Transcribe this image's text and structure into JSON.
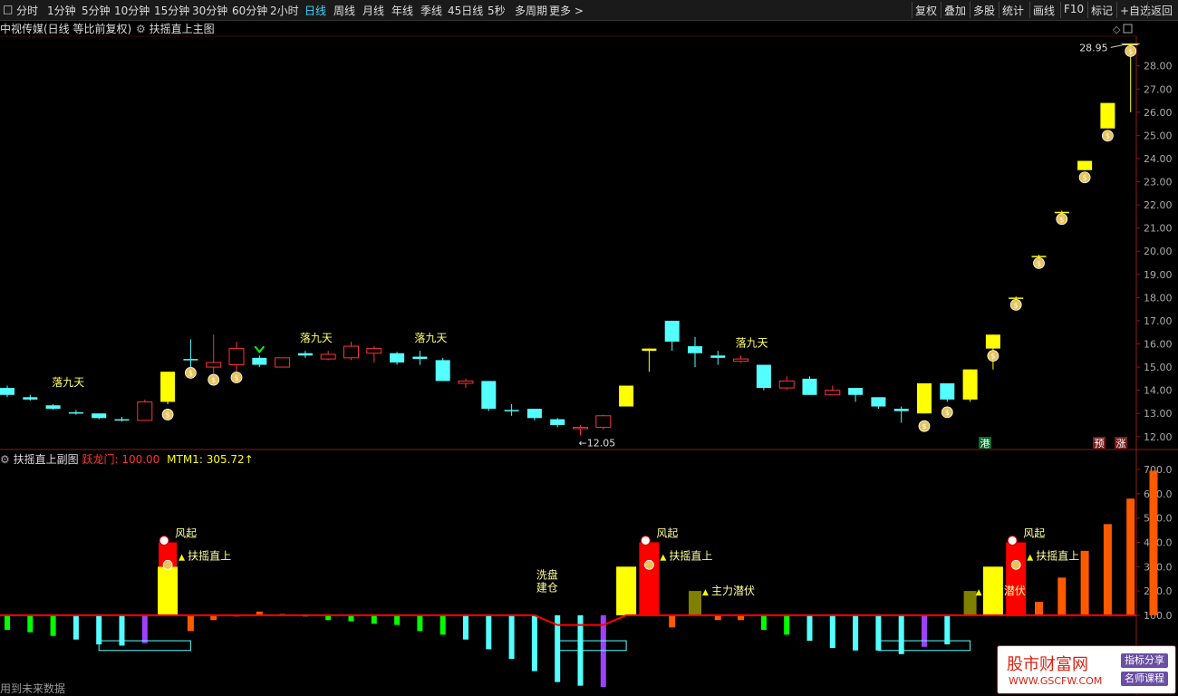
{
  "toolbar": {
    "left": [
      "分时",
      "1分钟",
      "5分钟",
      "10分钟",
      "15分钟",
      "30分钟",
      "60分钟",
      "2小时",
      "日线",
      "周线",
      "月线",
      "年线",
      "季线",
      "45日线",
      "5秒",
      "多周期",
      "更多 >"
    ],
    "active": "日线",
    "right": [
      "复权",
      "叠加",
      "多股",
      "统计",
      "画线",
      "F10",
      "标记",
      "+自选",
      "返回"
    ]
  },
  "main": {
    "title": "中视传媒(日线 等比前复权)",
    "indicator": "扶摇直上主图",
    "price_high_label": "28.95",
    "price_low_label": "12.05",
    "y_ticks": [
      "28.00",
      "27.00",
      "26.00",
      "25.00",
      "24.00",
      "23.00",
      "22.00",
      "21.00",
      "20.00",
      "19.00",
      "18.00",
      "17.00",
      "16.00",
      "15.00",
      "14.00",
      "13.00",
      "12.00"
    ],
    "signal_text": "落九天",
    "badges": [
      "港",
      "预",
      "涨"
    ]
  },
  "sub": {
    "title": "扶摇直上副图",
    "ylm_label": "跃龙门:",
    "ylm_value": "100.00",
    "mtm_label": "MTM1:",
    "mtm_value": "305.72↑",
    "y_ticks": [
      "700.0",
      "600.0",
      "500.0",
      "400.0",
      "300.0",
      "200.0",
      "100.0"
    ],
    "labels": {
      "fengqi": "风起",
      "fuyao": "扶摇直上",
      "xipan1": "洗盘",
      "xipan2": "建仓",
      "zhuli": "主力潜伏"
    }
  },
  "footer_note": "用到未来数据",
  "watermark": {
    "main": "股市财富网",
    "url": "WWW.GSCFW.COM",
    "tag1": "指标分享",
    "tag2": "名师课程"
  },
  "colors": {
    "up": "#ff3333",
    "down": "#54ffff",
    "yellow": "#ffff00",
    "orange": "#ff5a00",
    "purple": "#a040ff",
    "green": "#00ff00",
    "olive": "#808000",
    "redline": "#ff0000",
    "gold": "#e8c35a"
  },
  "chart_data": {
    "type": "candlestick",
    "ylim": [
      11.6,
      29.2
    ],
    "candles": [
      {
        "o": 13.8,
        "c": 14.1,
        "h": 14.2,
        "l": 13.7,
        "k": "c"
      },
      {
        "o": 13.6,
        "c": 13.7,
        "h": 13.8,
        "l": 13.55,
        "k": "c"
      },
      {
        "o": 13.2,
        "c": 13.35,
        "h": 13.4,
        "l": 13.15,
        "k": "c"
      },
      {
        "o": 13.0,
        "c": 13.05,
        "h": 13.15,
        "l": 12.95,
        "k": "c"
      },
      {
        "o": 12.8,
        "c": 13.0,
        "h": 13.0,
        "l": 12.75,
        "k": "c"
      },
      {
        "o": 12.7,
        "c": 12.75,
        "h": 12.85,
        "l": 12.65,
        "k": "c"
      },
      {
        "o": 12.7,
        "c": 13.5,
        "h": 13.6,
        "l": 12.7,
        "k": "u"
      },
      {
        "o": 13.5,
        "c": 14.8,
        "h": 14.8,
        "l": 13.4,
        "k": "y"
      },
      {
        "o": 15.3,
        "c": 15.35,
        "h": 16.2,
        "l": 14.7,
        "k": "c"
      },
      {
        "o": 15.0,
        "c": 15.2,
        "h": 16.4,
        "l": 14.7,
        "k": "u"
      },
      {
        "o": 15.1,
        "c": 15.8,
        "h": 16.1,
        "l": 14.8,
        "k": "u"
      },
      {
        "o": 15.1,
        "c": 15.4,
        "h": 15.5,
        "l": 15.0,
        "k": "c"
      },
      {
        "o": 15.0,
        "c": 15.4,
        "h": 15.4,
        "l": 15.0,
        "k": "u"
      },
      {
        "o": 15.6,
        "c": 15.5,
        "h": 15.7,
        "l": 15.4,
        "k": "c"
      },
      {
        "o": 15.35,
        "c": 15.55,
        "h": 15.7,
        "l": 15.3,
        "k": "u"
      },
      {
        "o": 15.4,
        "c": 15.9,
        "h": 16.1,
        "l": 15.3,
        "k": "u"
      },
      {
        "o": 15.6,
        "c": 15.8,
        "h": 15.9,
        "l": 15.2,
        "k": "u"
      },
      {
        "o": 15.6,
        "c": 15.2,
        "h": 15.65,
        "l": 15.1,
        "k": "c"
      },
      {
        "o": 15.45,
        "c": 15.35,
        "h": 15.7,
        "l": 15.1,
        "k": "c"
      },
      {
        "o": 15.3,
        "c": 14.4,
        "h": 15.4,
        "l": 14.4,
        "k": "c"
      },
      {
        "o": 14.3,
        "c": 14.4,
        "h": 14.5,
        "l": 14.1,
        "k": "u"
      },
      {
        "o": 14.4,
        "c": 13.2,
        "h": 14.4,
        "l": 13.1,
        "k": "c"
      },
      {
        "o": 13.15,
        "c": 13.1,
        "h": 13.4,
        "l": 12.9,
        "k": "c"
      },
      {
        "o": 13.2,
        "c": 12.8,
        "h": 13.2,
        "l": 12.7,
        "k": "c"
      },
      {
        "o": 12.75,
        "c": 12.5,
        "h": 12.8,
        "l": 12.4,
        "k": "c"
      },
      {
        "o": 12.35,
        "c": 12.4,
        "h": 12.5,
        "l": 12.05,
        "k": "u"
      },
      {
        "o": 12.4,
        "c": 12.9,
        "h": 12.95,
        "l": 12.3,
        "k": "u"
      },
      {
        "o": 13.3,
        "c": 14.2,
        "h": 14.2,
        "l": 13.3,
        "k": "y"
      },
      {
        "o": 15.7,
        "c": 15.8,
        "h": 15.8,
        "l": 14.8,
        "k": "y"
      },
      {
        "o": 17.0,
        "c": 16.1,
        "h": 17.0,
        "l": 15.7,
        "k": "c"
      },
      {
        "o": 15.9,
        "c": 15.6,
        "h": 16.3,
        "l": 15.0,
        "k": "c"
      },
      {
        "o": 15.5,
        "c": 15.4,
        "h": 15.7,
        "l": 15.1,
        "k": "c"
      },
      {
        "o": 15.25,
        "c": 15.35,
        "h": 15.5,
        "l": 15.2,
        "k": "u"
      },
      {
        "o": 15.1,
        "c": 14.1,
        "h": 15.1,
        "l": 14.0,
        "k": "c"
      },
      {
        "o": 14.1,
        "c": 14.4,
        "h": 14.6,
        "l": 14.0,
        "k": "u"
      },
      {
        "o": 14.5,
        "c": 13.8,
        "h": 14.6,
        "l": 13.8,
        "k": "c"
      },
      {
        "o": 13.8,
        "c": 14.0,
        "h": 14.2,
        "l": 13.8,
        "k": "u"
      },
      {
        "o": 14.1,
        "c": 13.8,
        "h": 14.1,
        "l": 13.5,
        "k": "c"
      },
      {
        "o": 13.7,
        "c": 13.3,
        "h": 13.7,
        "l": 13.2,
        "k": "c"
      },
      {
        "o": 13.2,
        "c": 13.1,
        "h": 13.3,
        "l": 12.6,
        "k": "c"
      },
      {
        "o": 13.0,
        "c": 14.3,
        "h": 14.3,
        "l": 13.0,
        "k": "y"
      },
      {
        "o": 14.3,
        "c": 13.6,
        "h": 14.3,
        "l": 13.5,
        "k": "c"
      },
      {
        "o": 13.6,
        "c": 14.9,
        "h": 14.9,
        "l": 13.5,
        "k": "y"
      },
      {
        "o": 15.8,
        "c": 16.4,
        "h": 16.4,
        "l": 14.9,
        "k": "y"
      },
      {
        "o": 18.0,
        "c": 18.0,
        "h": 18.05,
        "l": 17.9,
        "k": "y"
      },
      {
        "o": 19.8,
        "c": 19.8,
        "h": 19.85,
        "l": 19.7,
        "k": "y"
      },
      {
        "o": 21.7,
        "c": 21.7,
        "h": 21.75,
        "l": 21.6,
        "k": "y"
      },
      {
        "o": 23.5,
        "c": 23.9,
        "h": 23.9,
        "l": 23.5,
        "k": "y"
      },
      {
        "o": 25.3,
        "c": 26.4,
        "h": 26.4,
        "l": 25.3,
        "k": "y"
      },
      {
        "o": 28.95,
        "c": 28.95,
        "h": 28.95,
        "l": 26.0,
        "k": "y"
      }
    ],
    "signal_idx": [
      1,
      13,
      18,
      32
    ],
    "bag_idx": [
      7,
      8,
      9,
      10,
      40,
      41,
      43,
      44,
      45,
      46,
      47,
      48,
      49
    ],
    "arrow_idx": [
      11
    ],
    "sub": {
      "ylim": [
        -210,
        730
      ],
      "baseline": 100,
      "bars": [
        {
          "v": 40,
          "k": "green"
        },
        {
          "v": 30,
          "k": "green"
        },
        {
          "v": 15,
          "k": "green"
        },
        {
          "v": 0,
          "k": "cyan"
        },
        {
          "v": -20,
          "k": "cyan"
        },
        {
          "v": -25,
          "k": "cyan"
        },
        {
          "v": -15,
          "k": "purple"
        },
        {
          "v": 300,
          "k": "yellow"
        },
        {
          "v": 35,
          "k": "orange"
        },
        {
          "v": 80,
          "k": "orange"
        },
        {
          "v": 95,
          "k": "orange"
        },
        {
          "v": 115,
          "k": "orange"
        },
        {
          "v": 105,
          "k": "green"
        },
        {
          "v": 95,
          "k": "green"
        },
        {
          "v": 80,
          "k": "green"
        },
        {
          "v": 75,
          "k": "green"
        },
        {
          "v": 65,
          "k": "green"
        },
        {
          "v": 60,
          "k": "green"
        },
        {
          "v": 35,
          "k": "green"
        },
        {
          "v": 20,
          "k": "green"
        },
        {
          "v": 0,
          "k": "cyan"
        },
        {
          "v": -40,
          "k": "cyan"
        },
        {
          "v": -80,
          "k": "cyan"
        },
        {
          "v": -130,
          "k": "cyan"
        },
        {
          "v": -175,
          "k": "cyan"
        },
        {
          "v": -190,
          "k": "cyan"
        },
        {
          "v": -195,
          "k": "purple"
        },
        {
          "v": 300,
          "k": "yellow"
        },
        {
          "v": 400,
          "k": "red"
        },
        {
          "v": 50,
          "k": "orange"
        },
        {
          "v": 200,
          "k": "olive"
        },
        {
          "v": 80,
          "k": "orange"
        },
        {
          "v": 80,
          "k": "orange"
        },
        {
          "v": 40,
          "k": "green"
        },
        {
          "v": 20,
          "k": "green"
        },
        {
          "v": -5,
          "k": "cyan"
        },
        {
          "v": -35,
          "k": "cyan"
        },
        {
          "v": -45,
          "k": "cyan"
        },
        {
          "v": -45,
          "k": "cyan"
        },
        {
          "v": -60,
          "k": "cyan"
        },
        {
          "v": -30,
          "k": "purple"
        },
        {
          "v": -20,
          "k": "cyan"
        },
        {
          "v": 200,
          "k": "olive"
        },
        {
          "v": 300,
          "k": "yellow"
        },
        {
          "v": 400,
          "k": "red"
        },
        {
          "v": 155,
          "k": "orange"
        },
        {
          "v": 255,
          "k": "orange"
        },
        {
          "v": 365,
          "k": "orange"
        },
        {
          "v": 475,
          "k": "orange"
        },
        {
          "v": 580,
          "k": "orange"
        },
        {
          "v": 695,
          "k": "orange"
        }
      ],
      "overlay": [
        {
          "i": 7,
          "v": 400,
          "k": "red"
        }
      ]
    }
  }
}
